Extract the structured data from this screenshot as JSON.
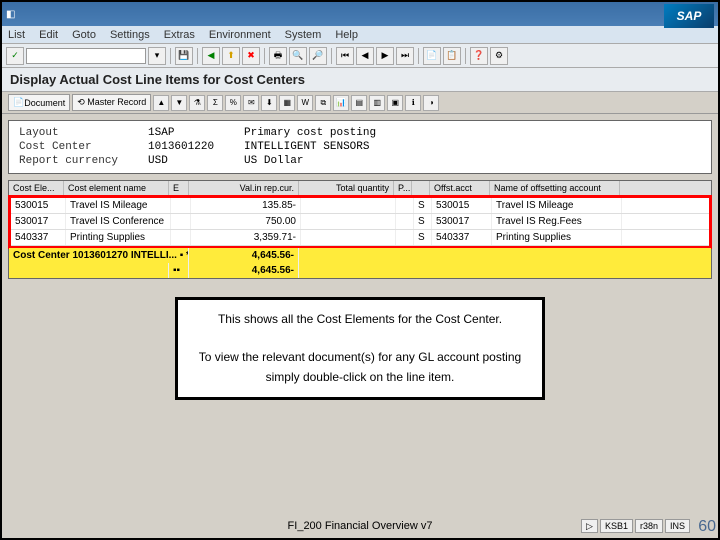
{
  "titlebar": {
    "app_icon": "◧"
  },
  "menu": {
    "items": [
      "List",
      "Edit",
      "Goto",
      "Settings",
      "Extras",
      "Environment",
      "System",
      "Help"
    ]
  },
  "toolbar": {
    "back": "◄",
    "check": "✓",
    "save": "💾",
    "back2": "◀",
    "exit": "❌",
    "cancel": "✖",
    "print": "🖨",
    "find": "🔍",
    "findnext": "🔎",
    "first": "⏮",
    "prev": "⏪",
    "next": "⏩",
    "last": "⏭",
    "help": "❓"
  },
  "page_title": "Display Actual Cost Line Items for Cost Centers",
  "app_toolbar": {
    "document": "Document",
    "master": "⟲ Master Record"
  },
  "info": {
    "labels": {
      "layout": "Layout",
      "costcenter": "Cost Center",
      "currency": "Report currency"
    },
    "layout": "1SAP",
    "costcenter": "1013601220",
    "currency": "USD",
    "desc_label": "Primary cost posting",
    "desc_cc": "INTELLIGENT SENSORS",
    "desc_curr": "US Dollar"
  },
  "grid": {
    "headers": {
      "elem": "Cost Ele...",
      "name": "Cost element name",
      "e": "E",
      "val": "Val.in rep.cur.",
      "qty": "Total quantity",
      "p": "P...",
      "s": " ",
      "acct": "Offst.acct",
      "acctname": "Name of offsetting account"
    },
    "rows": [
      {
        "elem": "530015",
        "name": "Travel IS Mileage",
        "val": "135.85-",
        "p": "",
        "s": "S",
        "acct": "530015",
        "acctname": "Travel IS Mileage"
      },
      {
        "elem": "530017",
        "name": "Travel IS Conference",
        "val": "750.00",
        "p": "",
        "s": "S",
        "acct": "530017",
        "acctname": "Travel IS Reg.Fees"
      },
      {
        "elem": "540337",
        "name": "Printing Supplies",
        "val": "3,359.71-",
        "p": "",
        "s": "S",
        "acct": "540337",
        "acctname": "Printing Supplies"
      }
    ],
    "subtotal1": {
      "label": "Cost Center 1013601270 INTELLI... ▪ *",
      "val": "4,645.56-"
    },
    "subtotal2": {
      "label": "",
      "marker": "▪▪",
      "val": "4,645.56-"
    }
  },
  "instruction": {
    "line1": "This shows all the Cost Elements for the Cost Center.",
    "line2": "To view the relevant document(s) for any GL account posting simply double-click on the line item."
  },
  "footer": {
    "center": "FI_200 Financial Overview v7",
    "status": [
      "▷",
      "KSB1",
      "r38n",
      "INS"
    ],
    "slide": "60"
  }
}
